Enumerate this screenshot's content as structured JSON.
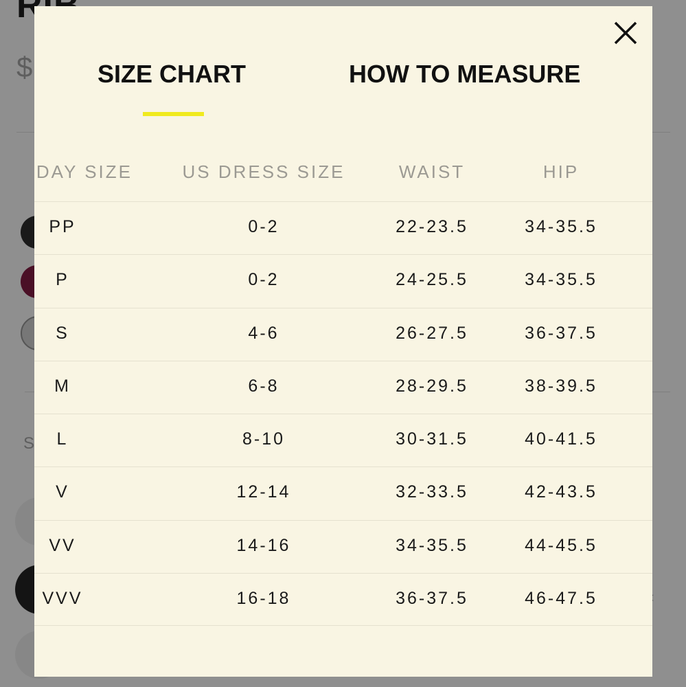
{
  "background": {
    "title": "RIB",
    "price_symbol": "$",
    "section_letter": "S",
    "arrow": "‹"
  },
  "modal": {
    "close_icon": "close-icon",
    "tabs": [
      {
        "label": "SIZE CHART",
        "active": true
      },
      {
        "label": "HOW TO MEASURE",
        "active": false
      }
    ],
    "accent_color": "#f0ea1e",
    "table": {
      "headers": [
        "SUNDAY SIZE",
        "US DRESS SIZE",
        "WAIST",
        "HIP"
      ],
      "rows": [
        [
          "PP",
          "0-2",
          "22-23.5",
          "34-35.5"
        ],
        [
          "P",
          "0-2",
          "24-25.5",
          "34-35.5"
        ],
        [
          "S",
          "4-6",
          "26-27.5",
          "36-37.5"
        ],
        [
          "M",
          "6-8",
          "28-29.5",
          "38-39.5"
        ],
        [
          "L",
          "8-10",
          "30-31.5",
          "40-41.5"
        ],
        [
          "V",
          "12-14",
          "32-33.5",
          "42-43.5"
        ],
        [
          "VV",
          "14-16",
          "34-35.5",
          "44-45.5"
        ],
        [
          "VVV",
          "16-18",
          "36-37.5",
          "46-47.5"
        ]
      ]
    }
  }
}
